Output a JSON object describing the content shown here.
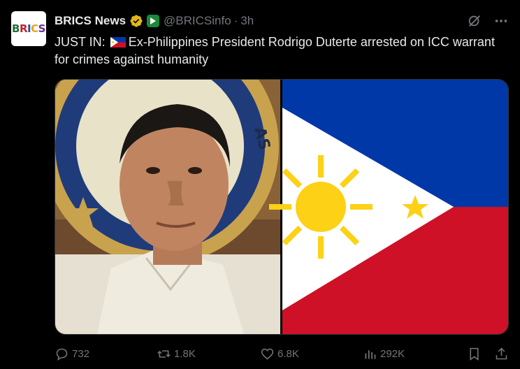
{
  "author": {
    "avatar_text": "BRICS",
    "name": "BRICS News",
    "handle": "@BRICSinfo",
    "time": "3h",
    "separator": "·"
  },
  "tweet": {
    "prefix": "JUST IN:",
    "body": "Ex-Philippines President Rodrigo Duterte arrested on ICC warrant for crimes against humanity"
  },
  "actions": {
    "replies": "732",
    "reposts": "1.8K",
    "likes": "6.8K",
    "views": "292K"
  },
  "colors": {
    "background": "#000000",
    "text": "#e7e9ea",
    "muted": "#71767b",
    "verified_gold": "#e2b719",
    "flag_blue": "#0038a8",
    "flag_red": "#ce1126",
    "flag_yellow": "#fcd116"
  },
  "icons": [
    "verified-badge-icon",
    "affiliate-icon",
    "grok-icon",
    "more-icon",
    "reply-icon",
    "repost-icon",
    "like-icon",
    "views-icon",
    "bookmark-icon",
    "share-icon"
  ]
}
